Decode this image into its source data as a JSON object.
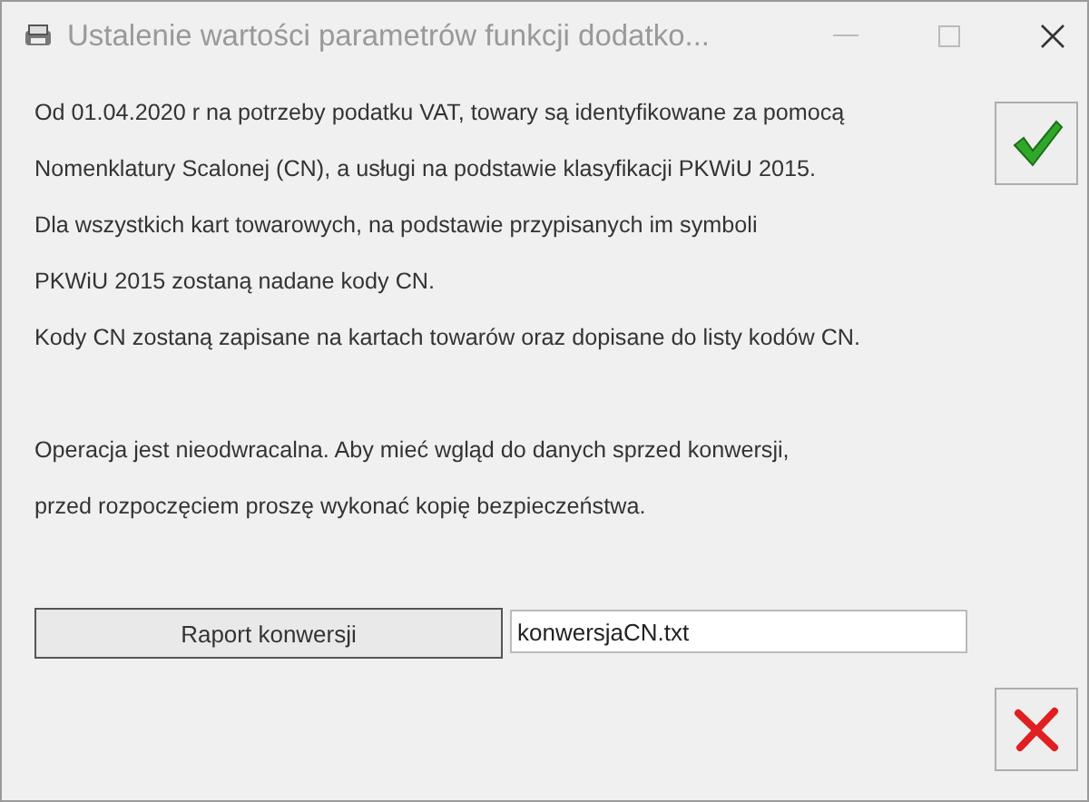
{
  "window": {
    "title": "Ustalenie wartości parametrów funkcji dodatko..."
  },
  "paragraphs": [
    [
      "Od 01.04.2020 r na potrzeby podatku VAT, towary są identyfikowane za pomocą",
      "Nomenklatury Scalonej (CN), a usługi na podstawie klasyfikacji PKWiU 2015.",
      "Dla wszystkich kart towarowych, na podstawie przypisanych im symboli",
      "PKWiU 2015 zostaną nadane kody CN.",
      "Kody CN zostaną zapisane na kartach towarów oraz dopisane do listy kodów CN."
    ],
    [
      "Operacja jest nieodwracalna. Aby mieć wgląd do danych sprzed konwersji,",
      "przed rozpoczęciem proszę wykonać kopię bezpieczeństwa."
    ]
  ],
  "report_button": {
    "label": "Raport konwersji"
  },
  "file_field": {
    "value": "konwersjaCN.txt"
  }
}
